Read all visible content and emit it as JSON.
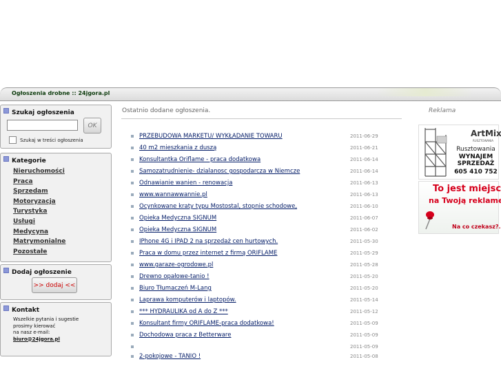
{
  "header": {
    "title": "Ogłoszenia drobne :: 24jgora.pl"
  },
  "search": {
    "heading": "Szukaj ogłoszenia",
    "input_value": "",
    "button_label": "OK",
    "checkbox_label": "Szukaj w treści ogłoszenia"
  },
  "categories": {
    "heading": "Kategorie",
    "items": [
      "Nieruchomości",
      "Praca",
      "Sprzedam",
      "Motoryzacja",
      "Turystyka",
      "Usługi",
      "Medycyna",
      "Matrymonialne",
      "Pozostałe"
    ]
  },
  "add": {
    "heading": "Dodaj ogłoszenie",
    "button_label": ">> dodaj <<"
  },
  "contact": {
    "heading": "Kontakt",
    "line1": "Wszelkie pytania i sugestie",
    "line2": "prosimy kierować",
    "line3": "na nasz e-mail:",
    "email": "biuro@24jgora.pl"
  },
  "main": {
    "heading": "Ostatnio dodane ogłoszenia.",
    "listings": [
      {
        "title": "PRZEBUDOWA MARKETU/ WYKŁADANIE TOWARU",
        "date": "2011-06-29"
      },
      {
        "title": "40 m2 mieszkania z duszą",
        "date": "2011-06-21"
      },
      {
        "title": "Konsultantka Oriflame - praca dodatkowa",
        "date": "2011-06-14"
      },
      {
        "title": "Samozatrudnienie- dzialanosc gospodarcza w Niemcze",
        "date": "2011-06-14"
      },
      {
        "title": "Odnawianie wanien - renowacja",
        "date": "2011-06-13"
      },
      {
        "title": "www.wannawwannie.pl",
        "date": "2011-06-13"
      },
      {
        "title": "Ocynkowane kraty typu Mostostal, stopnie schodowe,",
        "date": "2011-06-10"
      },
      {
        "title": "Opieka Medyczna SIGNUM",
        "date": "2011-06-07"
      },
      {
        "title": "Opieka Medyczna SIGNUM",
        "date": "2011-06-02"
      },
      {
        "title": "IPhone 4G i IPAD 2 na sprzedaż cen hurtowych.",
        "date": "2011-05-30"
      },
      {
        "title": "Praca w domu przez internet z firmą ORIFLAME",
        "date": "2011-05-29"
      },
      {
        "title": "www.garaze-ogrodowe.pl",
        "date": "2011-05-28"
      },
      {
        "title": "Drewno opałowe-tanio !",
        "date": "2011-05-20"
      },
      {
        "title": "Biuro Tłumaczeń M-Lang",
        "date": "2011-05-20"
      },
      {
        "title": "Laprawa komputerów i laptopów.",
        "date": "2011-05-14"
      },
      {
        "title": "*** HYDRAULIKA od A do Z ***",
        "date": "2011-05-12"
      },
      {
        "title": "Konsultant firmy ORIFLAME-praca dodatkowa!",
        "date": "2011-05-09"
      },
      {
        "title": "Dochodowa praca z Betterware",
        "date": "2011-05-09"
      },
      {
        "title": "",
        "date": "2011-05-09"
      },
      {
        "title": "2-pokojowe - TANIO !",
        "date": "2011-05-08"
      }
    ]
  },
  "ads": {
    "heading": "Reklama",
    "ad1": {
      "brand": "ArtMix",
      "sub": "RUSZTOWANIA",
      "line1": "Rusztowania",
      "line2": "WYNAJEM",
      "line3": "SPRZEDAŻ",
      "phone": "605 410 752",
      "icon": "scaffolding-icon"
    },
    "ad2": {
      "line1": "To jest miejsce",
      "line2": "na Twoją reklamę!",
      "line3": "Na co czekasz?...",
      "icon": "pushpin-icon",
      "accent": "#d6001c"
    }
  },
  "colors": {
    "accent_square": "#8c98d8",
    "link": "#001a66",
    "date": "#888888"
  }
}
